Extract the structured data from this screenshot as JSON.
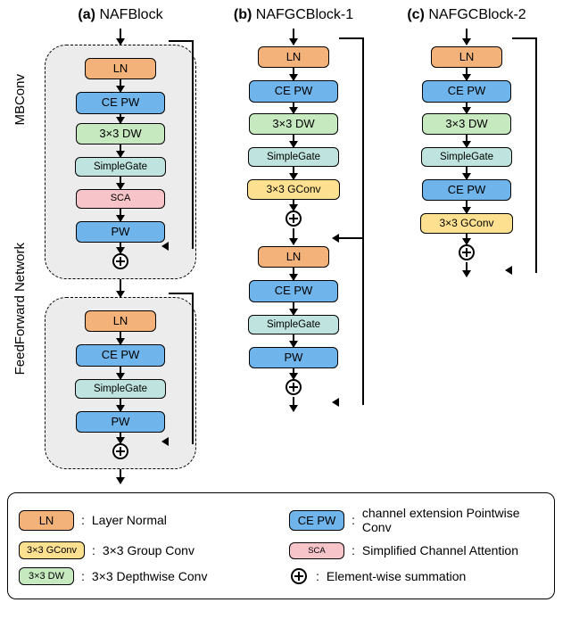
{
  "titles": {
    "a_letter": "(a)",
    "a_name": "NAFBlock",
    "b_letter": "(b)",
    "b_name": "NAFGCBlock-1",
    "c_letter": "(c)",
    "c_name": "NAFGCBlock-2"
  },
  "side": {
    "mbconv": "MBConv",
    "ffn": "FeedForward Network"
  },
  "blocks": {
    "ln": "LN",
    "cepw": "CE PW",
    "dw": "3×3 DW",
    "gate": "SimpleGate",
    "sca": "SCA",
    "pw": "PW",
    "gconv": "3×3 GConv"
  },
  "legend": {
    "ln": "Layer Normal",
    "cepw": "channel extension Pointwise Conv",
    "gconv": "3×3 Group Conv",
    "sca": "Simplified Channel Attention",
    "dw": "3×3 Depthwise Conv",
    "sum": "Element-wise summation"
  }
}
